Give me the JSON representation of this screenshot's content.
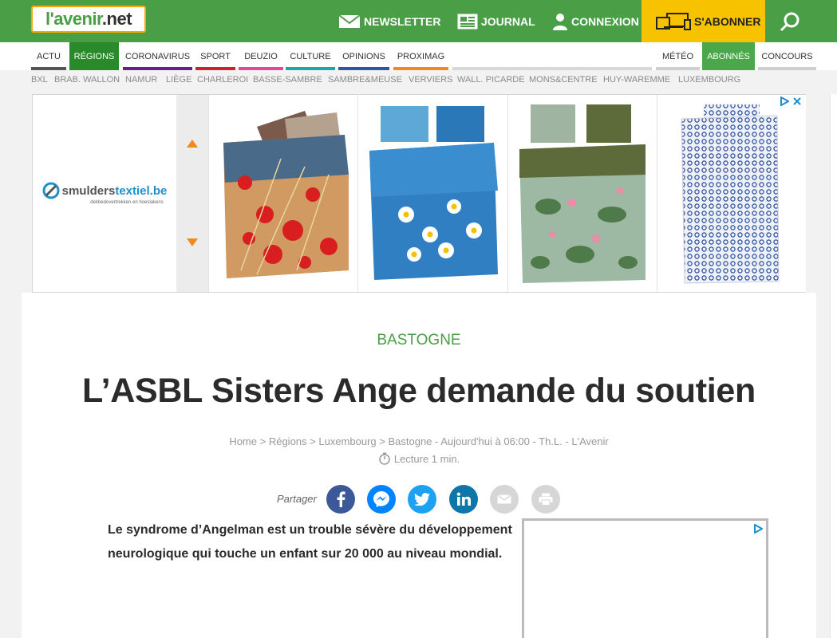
{
  "logo": {
    "prefix": "l'avenir",
    "suffix": ".net"
  },
  "topbar": {
    "newsletter": "NEWSLETTER",
    "journal": "JOURNAL",
    "connexion": "CONNEXION",
    "subscribe": "S'ABONNER"
  },
  "nav": {
    "items": [
      {
        "label": "ACTU",
        "color": "#555555"
      },
      {
        "label": "RÉGIONS",
        "color": "#2a8a2a"
      },
      {
        "label": "CORONAVIRUS",
        "color": "#6b1e8a"
      },
      {
        "label": "SPORT",
        "color": "#d0202a"
      },
      {
        "label": "DEUZIO",
        "color": "#e04a95"
      },
      {
        "label": "CULTURE",
        "color": "#18a6b3"
      },
      {
        "label": "OPINIONS",
        "color": "#2a57a6"
      },
      {
        "label": "PROXIMAG",
        "color": "#f08a1c"
      }
    ],
    "right": [
      {
        "label": "MÉTÉO",
        "color": "#cccccc"
      },
      {
        "label": "ABONNÉS",
        "color": "#4aa84a"
      },
      {
        "label": "CONCOURS",
        "color": "#cccccc"
      }
    ]
  },
  "regions": [
    "BXL",
    "BRAB. WALLON",
    "NAMUR",
    "LIÈGE",
    "CHARLEROI",
    "BASSE-SAMBRE",
    "SAMBRE&MEUSE",
    "VERVIERS",
    "WALL. PICARDE",
    "MONS&CENTRE",
    "HUY-WAREMME",
    "LUXEMBOURG"
  ],
  "ad": {
    "brand_main": "smulders",
    "brand_accent": "textiel.be",
    "tagline": "dekbedovertrekken en hoeslakens"
  },
  "article": {
    "category": "BASTOGNE",
    "title": "L’ASBL Sisters Ange demande du soutien",
    "breadcrumb": [
      "Home",
      "Régions",
      "Luxembourg",
      "Bastogne"
    ],
    "meta_tail": " - Aujourd'hui à 06:00 - Th.L. - L'Avenir",
    "read_time": "Lecture 1 min.",
    "share_label": "Partager",
    "lead": "Le syndrome d’Angelman est un trouble sévère du développement neurologique qui touche un enfant sur 20 000 au niveau mondial."
  },
  "colors": {
    "green": "#4a9e45",
    "yellow": "#f7c300",
    "facebook": "#3b5998",
    "messenger": "#0084ff",
    "twitter": "#1da1f2",
    "linkedin": "#0e76a8",
    "grey_share": "#d6d6d6"
  }
}
